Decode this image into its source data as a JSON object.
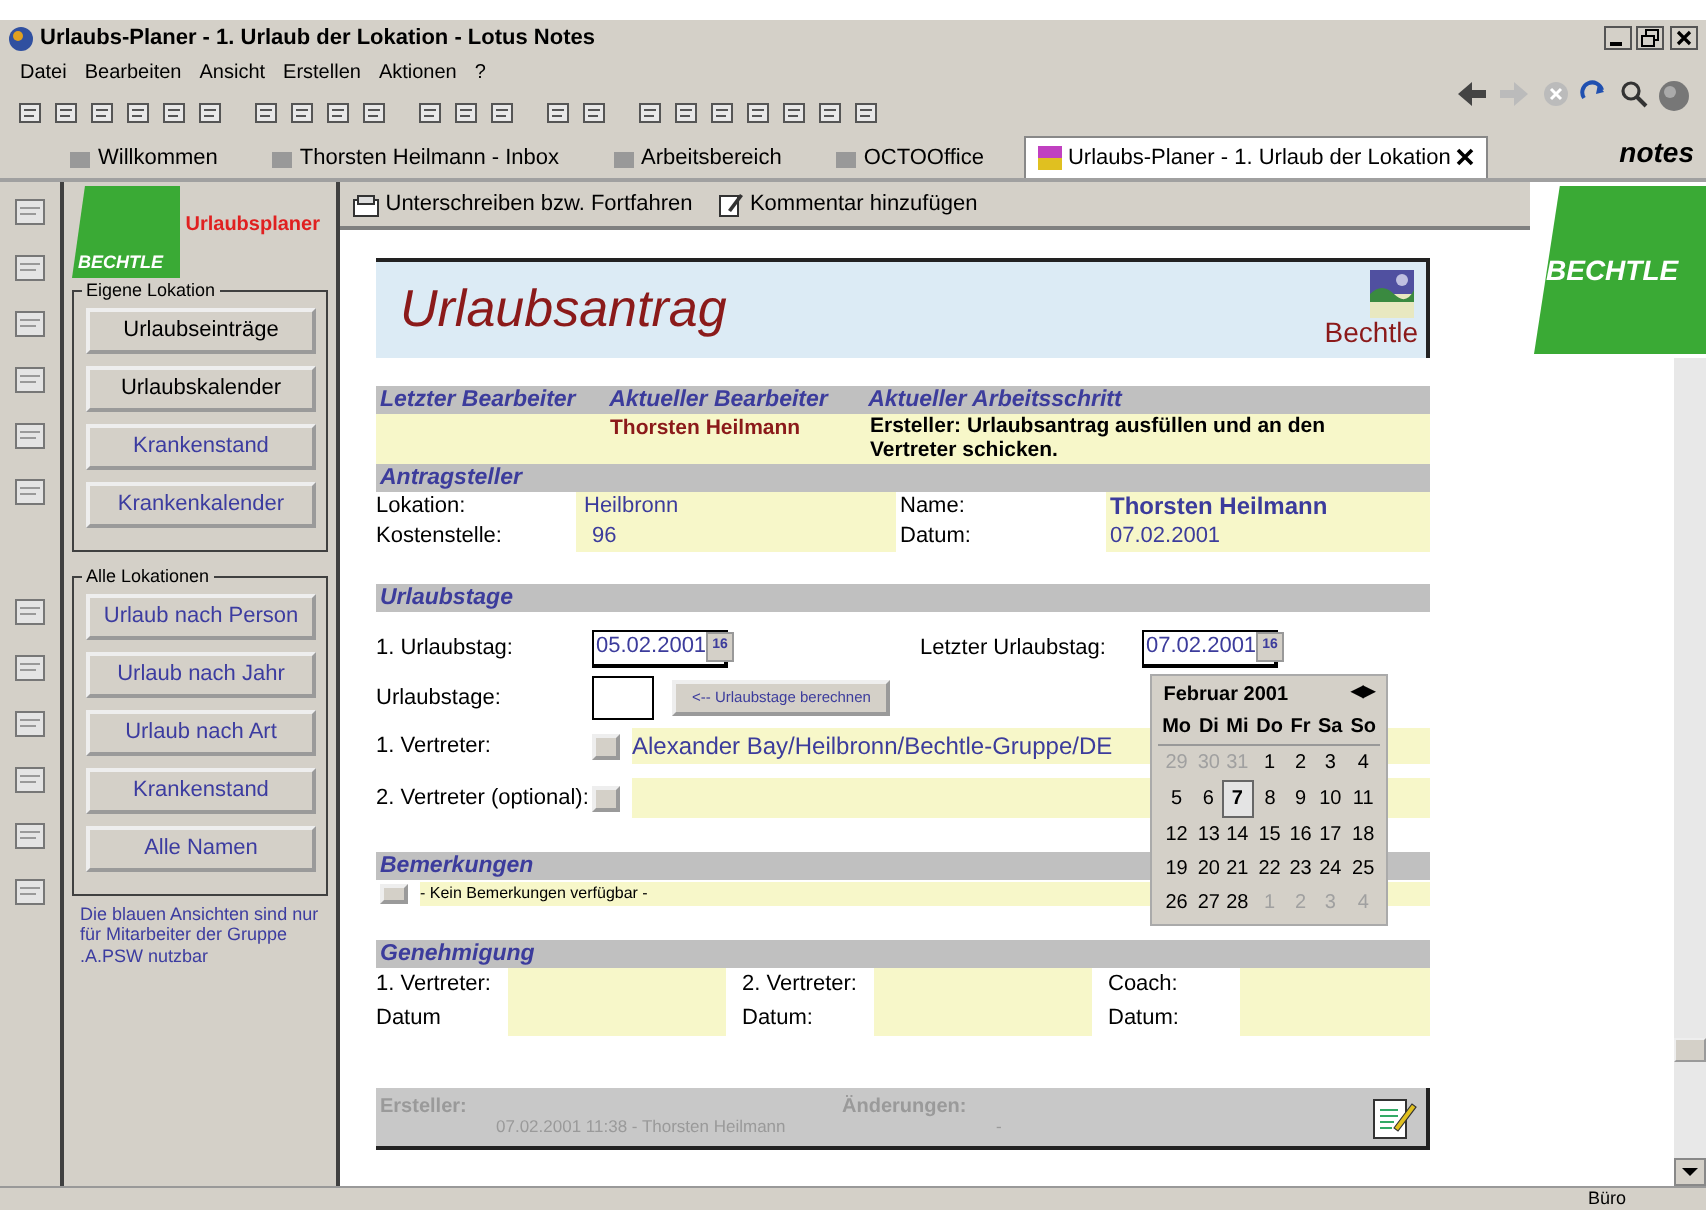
{
  "window": {
    "title": "Urlaubs-Planer - 1. Urlaub der Lokation - Lotus Notes"
  },
  "menu": [
    "Datei",
    "Bearbeiten",
    "Ansicht",
    "Erstellen",
    "Aktionen",
    "?"
  ],
  "tabs": [
    {
      "label": "Willkommen",
      "selected": false
    },
    {
      "label": "Thorsten Heilmann - Inbox",
      "selected": false
    },
    {
      "label": "Arbeitsbereich",
      "selected": false
    },
    {
      "label": "OCTOOffice",
      "selected": false
    },
    {
      "label": "Urlaubs-Planer - 1. Urlaub der Lokation",
      "selected": true
    }
  ],
  "brand": "notes",
  "sidebar": {
    "logo": "BECHTLE",
    "app_title": "Urlaubsplaner",
    "groups": [
      {
        "title": "Eigene Lokation",
        "buttons": [
          {
            "label": "Urlaubseinträge",
            "restricted": false
          },
          {
            "label": "Urlaubskalender",
            "restricted": false
          },
          {
            "label": "Krankenstand",
            "restricted": true
          },
          {
            "label": "Krankenkalender",
            "restricted": true
          }
        ]
      },
      {
        "title": "Alle Lokationen",
        "buttons": [
          {
            "label": "Urlaub nach Person",
            "restricted": true
          },
          {
            "label": "Urlaub nach Jahr",
            "restricted": true
          },
          {
            "label": "Urlaub nach Art",
            "restricted": true
          },
          {
            "label": "Krankenstand",
            "restricted": true
          },
          {
            "label": "Alle Namen",
            "restricted": true
          }
        ]
      }
    ],
    "note": "Die blauen Ansichten sind nur für Mitarbeiter der Gruppe .A.PSW nutzbar"
  },
  "actions": [
    "Unterschreiben bzw. Fortfahren",
    "Kommentar hinzufügen"
  ],
  "right_logo": "BECHTLE",
  "form": {
    "title": "Urlaubsantrag",
    "company": "Bechtle",
    "workflow": {
      "headers": [
        "Letzter Bearbeiter",
        "Aktueller Bearbeiter",
        "Aktueller Arbeitsschritt"
      ],
      "current_editor": "Thorsten Heilmann",
      "current_step": "Ersteller: Urlaubsantrag ausfüllen und an den Vertreter schicken."
    },
    "applicant": {
      "heading": "Antragsteller",
      "location_label": "Lokation:",
      "location": "Heilbronn",
      "name_label": "Name:",
      "name": "Thorsten Heilmann",
      "cost_label": "Kostenstelle:",
      "cost": "96",
      "date_label": "Datum:",
      "date": "07.02.2001"
    },
    "vacation": {
      "heading": "Urlaubstage",
      "first_label": "1. Urlaubstag:",
      "first": "05.02.2001",
      "last_label": "Letzter Urlaubstag:",
      "last": "07.02.2001",
      "first_picker": "16",
      "last_picker": "16",
      "days_label": "Urlaubstage:",
      "calc_button": "<-- Urlaubstage berechnen",
      "deputy1_label": "1. Vertreter:",
      "deputy1": "Alexander Bay/Heilbronn/Bechtle-Gruppe/DE",
      "deputy2_label": "2. Vertreter (optional):"
    },
    "calendar": {
      "month": "Februar 2001",
      "prev": "◀",
      "next": "▶",
      "weekdays": [
        "Mo",
        "Di",
        "Mi",
        "Do",
        "Fr",
        "Sa",
        "So"
      ],
      "weeks": [
        [
          {
            "d": "29",
            "outside": true,
            "selected": false
          },
          {
            "d": "30",
            "outside": true,
            "selected": false
          },
          {
            "d": "31",
            "outside": true,
            "selected": false
          },
          {
            "d": "1",
            "outside": false,
            "selected": false
          },
          {
            "d": "2",
            "outside": false,
            "selected": false
          },
          {
            "d": "3",
            "outside": false,
            "selected": false
          },
          {
            "d": "4",
            "outside": false,
            "selected": false
          }
        ],
        [
          {
            "d": "5",
            "outside": false,
            "selected": false
          },
          {
            "d": "6",
            "outside": false,
            "selected": false
          },
          {
            "d": "7",
            "outside": false,
            "selected": true
          },
          {
            "d": "8",
            "outside": false,
            "selected": false
          },
          {
            "d": "9",
            "outside": false,
            "selected": false
          },
          {
            "d": "10",
            "outside": false,
            "selected": false
          },
          {
            "d": "11",
            "outside": false,
            "selected": false
          }
        ],
        [
          {
            "d": "12",
            "outside": false,
            "selected": false
          },
          {
            "d": "13",
            "outside": false,
            "selected": false
          },
          {
            "d": "14",
            "outside": false,
            "selected": false
          },
          {
            "d": "15",
            "outside": false,
            "selected": false
          },
          {
            "d": "16",
            "outside": false,
            "selected": false
          },
          {
            "d": "17",
            "outside": false,
            "selected": false
          },
          {
            "d": "18",
            "outside": false,
            "selected": false
          }
        ],
        [
          {
            "d": "19",
            "outside": false,
            "selected": false
          },
          {
            "d": "20",
            "outside": false,
            "selected": false
          },
          {
            "d": "21",
            "outside": false,
            "selected": false
          },
          {
            "d": "22",
            "outside": false,
            "selected": false
          },
          {
            "d": "23",
            "outside": false,
            "selected": false
          },
          {
            "d": "24",
            "outside": false,
            "selected": false
          },
          {
            "d": "25",
            "outside": false,
            "selected": false
          }
        ],
        [
          {
            "d": "26",
            "outside": false,
            "selected": false
          },
          {
            "d": "27",
            "outside": false,
            "selected": false
          },
          {
            "d": "28",
            "outside": false,
            "selected": false
          },
          {
            "d": "1",
            "outside": true,
            "selected": false
          },
          {
            "d": "2",
            "outside": true,
            "selected": false
          },
          {
            "d": "3",
            "outside": true,
            "selected": false
          },
          {
            "d": "4",
            "outside": true,
            "selected": false
          }
        ]
      ]
    },
    "remarks": {
      "heading": "Bemerkungen",
      "text": "- Kein Bemerkungen verfügbar -"
    },
    "approval": {
      "heading": "Genehmigung",
      "columns": [
        {
          "label": "1. Vertreter:",
          "date_label": "Datum"
        },
        {
          "label": "2. Vertreter:",
          "date_label": "Datum:"
        },
        {
          "label": "Coach:",
          "date_label": "Datum:"
        }
      ]
    },
    "footer": {
      "creator_label": "Ersteller:",
      "creator": "07.02.2001 11:38  -  Thorsten Heilmann",
      "changes_label": "Änderungen:",
      "changes": "-"
    }
  },
  "status_bar": {
    "location": "Büro"
  }
}
